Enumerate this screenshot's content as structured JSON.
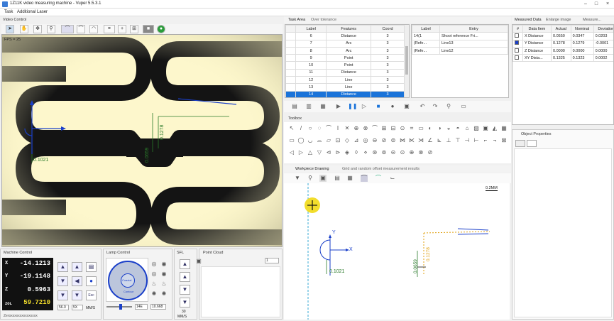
{
  "app": {
    "title": "1Z11K video measuring machine - Vuper 5.5.3.1"
  },
  "menu": [
    "Task",
    "Additional Laser"
  ],
  "video": {
    "panel_title": "Video Control",
    "fps": "FPS = 25",
    "dim_left": "0.1021",
    "dim_mid": "0.0659",
    "dim_right": "0.1278"
  },
  "task_area": {
    "tabs": [
      "Task Area",
      "Over tolerance"
    ],
    "headers": [
      "Label",
      "Features",
      "Coord"
    ],
    "rows": [
      [
        "6",
        "Distance",
        "3"
      ],
      [
        "7",
        "Arc",
        "3"
      ],
      [
        "8",
        "Arc",
        "3"
      ],
      [
        "9",
        "Point",
        "3"
      ],
      [
        "10",
        "Point",
        "3"
      ],
      [
        "11",
        "Distance",
        "3"
      ],
      [
        "12",
        "Line",
        "3"
      ],
      [
        "13",
        "Line",
        "3"
      ],
      [
        "14",
        "Distance",
        "3"
      ]
    ],
    "selected_index": 8
  },
  "entry_table": {
    "headers": [
      "Label",
      "Entry"
    ],
    "rows": [
      [
        "14(1",
        "Shoot reference Fri..."
      ],
      [
        "(Refe...",
        "Line13"
      ],
      [
        "(Refe...",
        "Line12"
      ]
    ]
  },
  "measured": {
    "tabs": [
      "Measured Data",
      "Enlarge image",
      "Measure..."
    ],
    "headers": [
      "#",
      "Data Item",
      "Actual",
      "Nominal",
      "Deviation"
    ],
    "rows": [
      {
        "checked": false,
        "item": "X Distance",
        "actual": "0.0550",
        "nominal": "0.0347",
        "deviation": "0.0203"
      },
      {
        "checked": true,
        "item": "Y Distance",
        "actual": "0.1278",
        "nominal": "0.1279",
        "deviation": "-0.0001"
      },
      {
        "checked": false,
        "item": "Z Distance",
        "actual": "0.0000",
        "nominal": "0.0000",
        "deviation": "0.0000"
      },
      {
        "checked": false,
        "item": "XY Dista...",
        "actual": "0.1325",
        "nominal": "0.1323",
        "deviation": "0.0002"
      }
    ]
  },
  "object_properties": {
    "title": "Object Properties"
  },
  "toolbox": {
    "title": "Toolbox"
  },
  "drawing": {
    "tabs": [
      "Workpiece Drawing",
      "Grid and random offset measurement results"
    ],
    "scale": "0.2MM",
    "dim_left": "0.1021",
    "dim_mid": "0.0659",
    "dim_right": "0.1278",
    "axis_x": "X",
    "axis_y": "Y"
  },
  "machine_control": {
    "title": "Machine Control",
    "x": "-14.1213",
    "y": "-19.1148",
    "z": "0.5963",
    "zoom": "59.7210",
    "labels": {
      "x": "X",
      "y": "Y",
      "z": "Z",
      "zoom": "ZOL"
    },
    "speed_a": "56.0",
    "speed_b": "5X",
    "unit": "MM/S",
    "esc_label": "Esc",
    "status": "Zeroxxxxxxxxxxxxxxx"
  },
  "lamp_control": {
    "title": "Lamp Control",
    "center": "Coaxial",
    "bottom": "Contour",
    "val_a": "14E",
    "val_b": "10.668"
  },
  "sfl": {
    "title": "SFL",
    "val": "30",
    "unit": "MM/S"
  },
  "point_cloud": {
    "title": "Point Cloud",
    "count": "1"
  }
}
